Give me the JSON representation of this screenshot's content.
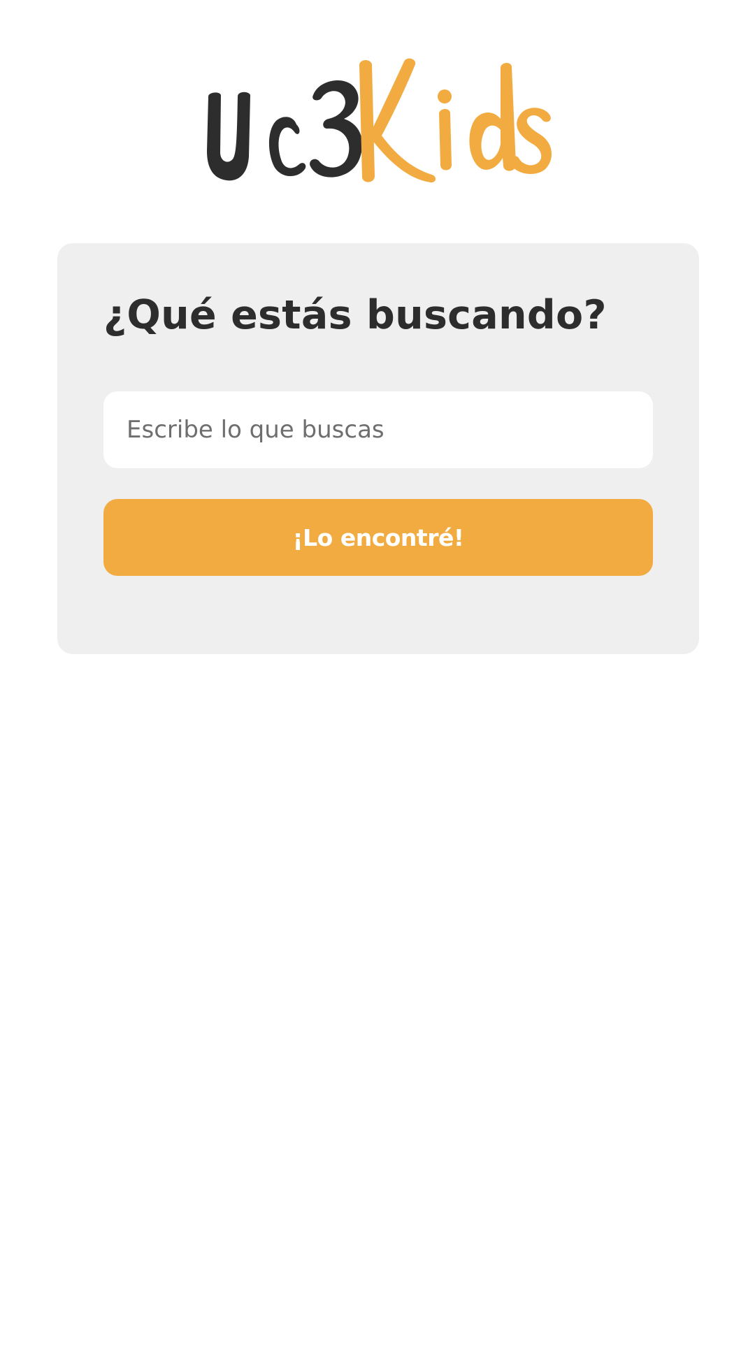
{
  "logo": {
    "text_part1": "Uc3",
    "text_part2": "Kids",
    "color_dark": "#2d2d2d",
    "color_accent": "#f2ab40"
  },
  "search_card": {
    "title": "¿Qué estás buscando?",
    "input_placeholder": "Escribe lo que buscas",
    "input_value": "",
    "button_label": "¡Lo encontré!"
  },
  "colors": {
    "card_background": "#efefef",
    "button_background": "#f2ab40",
    "title_text": "#2d2d2d"
  }
}
